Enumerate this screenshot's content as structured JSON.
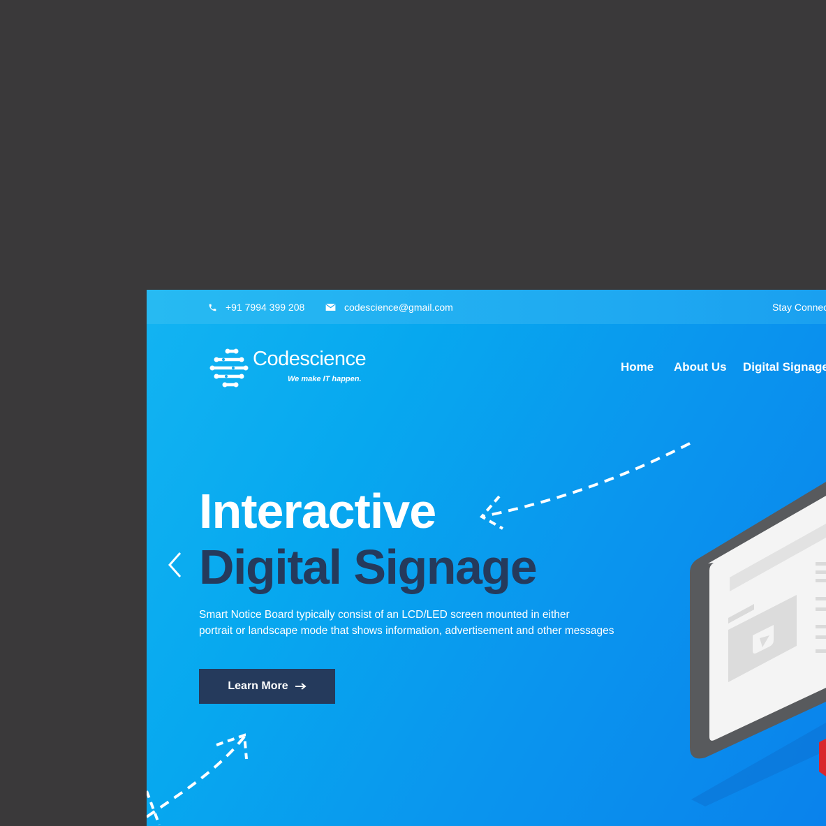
{
  "topbar": {
    "phone": "+91 7994 399 208",
    "email": "codescience@gmail.com",
    "stay_connected": "Stay Connec"
  },
  "logo": {
    "name": "Codescience",
    "tagline": "We make IT happen."
  },
  "nav": {
    "items": [
      "Home",
      "About Us",
      "Digital Signage"
    ]
  },
  "hero": {
    "title_line1": "Interactive",
    "title_line2": "Digital Signage",
    "description_line1": "Smart Notice Board typically consist of an LCD/LED screen mounted in either",
    "description_line2": "portrait or landscape mode that shows information, advertisement and other messages",
    "cta_label": "Learn More"
  },
  "colors": {
    "page_background": "#3a393a",
    "hero_gradient_start": "#13b4f2",
    "hero_gradient_end": "#0a82ec",
    "navy_accent": "#253a5c",
    "illustration_red": "#d9262c"
  },
  "icons": {
    "phone": "phone-icon",
    "email": "envelope-icon",
    "prev": "chevron-left-icon",
    "cta": "arrow-right-icon",
    "play": "play-icon"
  }
}
